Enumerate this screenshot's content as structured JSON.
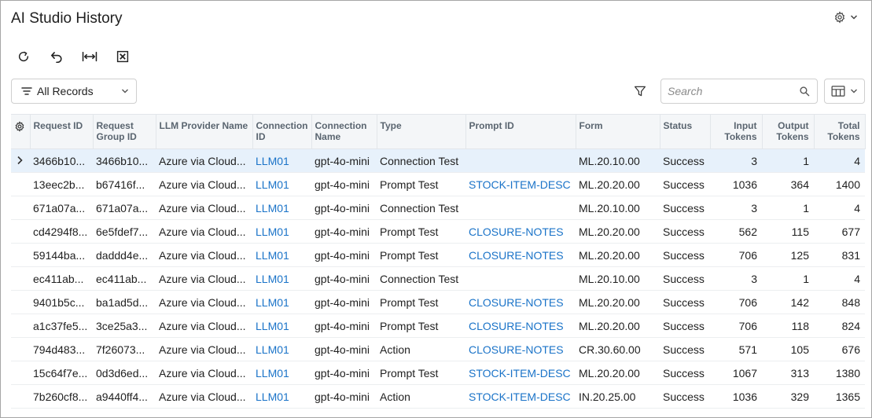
{
  "page": {
    "title": "AI Studio History"
  },
  "header": {
    "settings_icon": "gear-icon",
    "settings_chevron_icon": "chevron-down-icon"
  },
  "toolbar": {
    "buttons": [
      {
        "name": "refresh-button",
        "icon": "refresh-icon"
      },
      {
        "name": "undo-button",
        "icon": "undo-icon"
      },
      {
        "name": "fit-columns-button",
        "icon": "fit-width-icon"
      },
      {
        "name": "export-excel-button",
        "icon": "excel-icon"
      }
    ]
  },
  "filter": {
    "selected": "All Records",
    "icon": "filter-lines-icon"
  },
  "search": {
    "placeholder": "Search",
    "value": ""
  },
  "colors": {
    "link": "#1a73c8",
    "selected_row": "#e7f1fb",
    "header_bg": "#f4f6f8"
  },
  "table": {
    "columns": [
      {
        "key": "request_id",
        "line1": "Request ID",
        "line2": ""
      },
      {
        "key": "request_group_id",
        "line1": "Request",
        "line2": "Group ID"
      },
      {
        "key": "llm_provider",
        "line1": "LLM Provider Name",
        "line2": ""
      },
      {
        "key": "connection_id",
        "line1": "Connection",
        "line2": "ID"
      },
      {
        "key": "connection_name",
        "line1": "Connection",
        "line2": "Name"
      },
      {
        "key": "type",
        "line1": "Type",
        "line2": ""
      },
      {
        "key": "prompt_id",
        "line1": "Prompt ID",
        "line2": ""
      },
      {
        "key": "form",
        "line1": "Form",
        "line2": ""
      },
      {
        "key": "status",
        "line1": "Status",
        "line2": ""
      },
      {
        "key": "input_tokens",
        "line1": "Input",
        "line2": "Tokens"
      },
      {
        "key": "output_tokens",
        "line1": "Output",
        "line2": "Tokens"
      },
      {
        "key": "total_tokens",
        "line1": "Total",
        "line2": "Tokens"
      }
    ],
    "rows": [
      {
        "request_id": "3466b10...",
        "request_group_id": "3466b10...",
        "llm_provider": "Azure via Cloud...",
        "connection_id": "LLM01",
        "connection_name": "gpt-4o-mini",
        "type": "Connection Test",
        "prompt_id": "",
        "form": "ML.20.10.00",
        "status": "Success",
        "input_tokens": "3",
        "output_tokens": "1",
        "total_tokens": "4"
      },
      {
        "request_id": "13eec2b...",
        "request_group_id": "b67416f...",
        "llm_provider": "Azure via Cloud...",
        "connection_id": "LLM01",
        "connection_name": "gpt-4o-mini",
        "type": "Prompt Test",
        "prompt_id": "STOCK-ITEM-DESC",
        "form": "ML.20.20.00",
        "status": "Success",
        "input_tokens": "1036",
        "output_tokens": "364",
        "total_tokens": "1400"
      },
      {
        "request_id": "671a07a...",
        "request_group_id": "671a07a...",
        "llm_provider": "Azure via Cloud...",
        "connection_id": "LLM01",
        "connection_name": "gpt-4o-mini",
        "type": "Connection Test",
        "prompt_id": "",
        "form": "ML.20.10.00",
        "status": "Success",
        "input_tokens": "3",
        "output_tokens": "1",
        "total_tokens": "4"
      },
      {
        "request_id": "cd4294f8...",
        "request_group_id": "6e5fdef7...",
        "llm_provider": "Azure via Cloud...",
        "connection_id": "LLM01",
        "connection_name": "gpt-4o-mini",
        "type": "Prompt Test",
        "prompt_id": "CLOSURE-NOTES",
        "form": "ML.20.20.00",
        "status": "Success",
        "input_tokens": "562",
        "output_tokens": "115",
        "total_tokens": "677"
      },
      {
        "request_id": "59144ba...",
        "request_group_id": "daddd4e...",
        "llm_provider": "Azure via Cloud...",
        "connection_id": "LLM01",
        "connection_name": "gpt-4o-mini",
        "type": "Prompt Test",
        "prompt_id": "CLOSURE-NOTES",
        "form": "ML.20.20.00",
        "status": "Success",
        "input_tokens": "706",
        "output_tokens": "125",
        "total_tokens": "831"
      },
      {
        "request_id": "ec411ab...",
        "request_group_id": "ec411ab...",
        "llm_provider": "Azure via Cloud...",
        "connection_id": "LLM01",
        "connection_name": "gpt-4o-mini",
        "type": "Connection Test",
        "prompt_id": "",
        "form": "ML.20.10.00",
        "status": "Success",
        "input_tokens": "3",
        "output_tokens": "1",
        "total_tokens": "4"
      },
      {
        "request_id": "9401b5c...",
        "request_group_id": "ba1ad5d...",
        "llm_provider": "Azure via Cloud...",
        "connection_id": "LLM01",
        "connection_name": "gpt-4o-mini",
        "type": "Prompt Test",
        "prompt_id": "CLOSURE-NOTES",
        "form": "ML.20.20.00",
        "status": "Success",
        "input_tokens": "706",
        "output_tokens": "142",
        "total_tokens": "848"
      },
      {
        "request_id": "a1c37fe5...",
        "request_group_id": "3ce25a3...",
        "llm_provider": "Azure via Cloud...",
        "connection_id": "LLM01",
        "connection_name": "gpt-4o-mini",
        "type": "Prompt Test",
        "prompt_id": "CLOSURE-NOTES",
        "form": "ML.20.20.00",
        "status": "Success",
        "input_tokens": "706",
        "output_tokens": "118",
        "total_tokens": "824"
      },
      {
        "request_id": "794d483...",
        "request_group_id": "7f26073...",
        "llm_provider": "Azure via Cloud...",
        "connection_id": "LLM01",
        "connection_name": "gpt-4o-mini",
        "type": "Action",
        "prompt_id": "CLOSURE-NOTES",
        "form": "CR.30.60.00",
        "status": "Success",
        "input_tokens": "571",
        "output_tokens": "105",
        "total_tokens": "676"
      },
      {
        "request_id": "15c64f7e...",
        "request_group_id": "0d3d6ed...",
        "llm_provider": "Azure via Cloud...",
        "connection_id": "LLM01",
        "connection_name": "gpt-4o-mini",
        "type": "Prompt Test",
        "prompt_id": "STOCK-ITEM-DESC",
        "form": "ML.20.20.00",
        "status": "Success",
        "input_tokens": "1067",
        "output_tokens": "313",
        "total_tokens": "1380"
      },
      {
        "request_id": "7b260cf8...",
        "request_group_id": "a9440ff4...",
        "llm_provider": "Azure via Cloud...",
        "connection_id": "LLM01",
        "connection_name": "gpt-4o-mini",
        "type": "Action",
        "prompt_id": "STOCK-ITEM-DESC",
        "form": "IN.20.25.00",
        "status": "Success",
        "input_tokens": "1036",
        "output_tokens": "329",
        "total_tokens": "1365"
      }
    ]
  }
}
